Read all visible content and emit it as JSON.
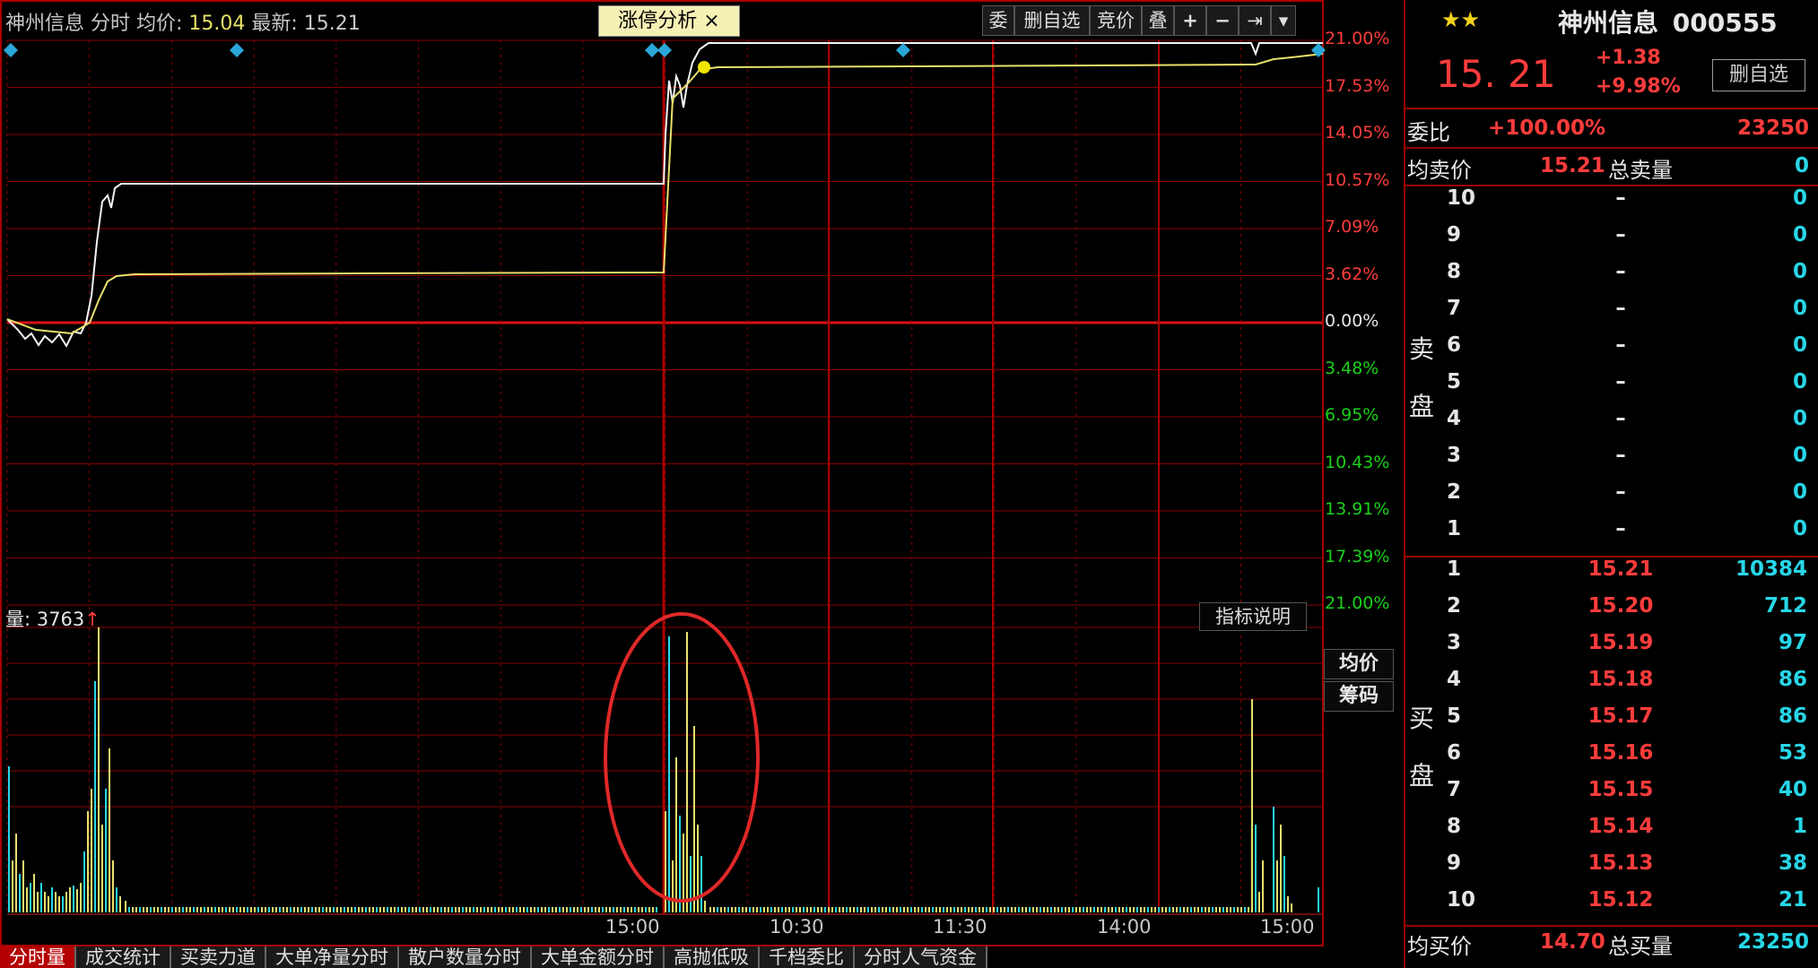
{
  "colors": {
    "red": "#ff3c3c",
    "green": "#1bd01b",
    "yellow": "#e8e06a",
    "cyan": "#27d7e8",
    "grid": "#8a0000"
  },
  "header": {
    "title": "神州信息 分时 均价: ",
    "avg_value": "15.04",
    "latest_label": " 最新: 15.21",
    "tab_label": "涨停分析 ×",
    "toolbar": [
      "委",
      "删自选",
      "竞价",
      "叠",
      "+",
      "−",
      "⇥",
      "▾"
    ]
  },
  "price_axis": {
    "labels": [
      "21.00%",
      "17.53%",
      "14.05%",
      "10.57%",
      "7.09%",
      "3.62%",
      "0.00%",
      "3.48%",
      "6.95%",
      "10.43%",
      "13.91%",
      "17.39%",
      "21.00%"
    ],
    "colors": [
      "red",
      "red",
      "red",
      "red",
      "red",
      "red",
      "white",
      "green",
      "green",
      "green",
      "green",
      "green",
      "green"
    ]
  },
  "volume": {
    "label": "量: 3763",
    "arrow": "↑",
    "button": "指标说明"
  },
  "side_buttons": [
    "均价",
    "筹码"
  ],
  "time_axis": [
    "15:00",
    "10:30",
    "11:30",
    "14:00",
    "15:00"
  ],
  "bottom_tabs": [
    "分时量",
    "成交统计",
    "买卖力道",
    "大单净量分时",
    "散户数量分时",
    "大单金额分时",
    "高抛低吸",
    "千档委比",
    "分时人气资金"
  ],
  "quote": {
    "stars": "★★",
    "name": "神州信息",
    "code": "000555",
    "price": "15. 21",
    "change": "+1.38",
    "change_pct": "+9.98%",
    "fav_button": "删自选",
    "weibi_label": "委比",
    "weibi_value": "+100.00%",
    "weibi_diff": "23250",
    "avg_sell_label": "均卖价",
    "avg_sell_price": "15.21",
    "total_sell_label": "总卖量",
    "total_sell_value": "0",
    "sell_side_label": "卖盘",
    "buy_side_label": "买盘",
    "avg_buy_label": "均买价",
    "avg_buy_price": "14.70",
    "total_buy_label": "总买量",
    "total_buy_value": "23250"
  },
  "sell_levels": [
    {
      "level": "10",
      "price": "–",
      "vol": "0"
    },
    {
      "level": "9",
      "price": "–",
      "vol": "0"
    },
    {
      "level": "8",
      "price": "–",
      "vol": "0"
    },
    {
      "level": "7",
      "price": "–",
      "vol": "0"
    },
    {
      "level": "6",
      "price": "–",
      "vol": "0"
    },
    {
      "level": "5",
      "price": "–",
      "vol": "0"
    },
    {
      "level": "4",
      "price": "–",
      "vol": "0"
    },
    {
      "level": "3",
      "price": "–",
      "vol": "0"
    },
    {
      "level": "2",
      "price": "–",
      "vol": "0"
    },
    {
      "level": "1",
      "price": "–",
      "vol": "0"
    }
  ],
  "buy_levels": [
    {
      "level": "1",
      "price": "15.21",
      "vol": "10384"
    },
    {
      "level": "2",
      "price": "15.20",
      "vol": "712"
    },
    {
      "level": "3",
      "price": "15.19",
      "vol": "97"
    },
    {
      "level": "4",
      "price": "15.18",
      "vol": "86"
    },
    {
      "level": "5",
      "price": "15.17",
      "vol": "86"
    },
    {
      "level": "6",
      "price": "15.16",
      "vol": "53"
    },
    {
      "level": "7",
      "price": "15.15",
      "vol": "40"
    },
    {
      "level": "8",
      "price": "15.14",
      "vol": "1"
    },
    {
      "level": "9",
      "price": "15.13",
      "vol": "38"
    },
    {
      "level": "10",
      "price": "15.12",
      "vol": "21"
    }
  ]
}
